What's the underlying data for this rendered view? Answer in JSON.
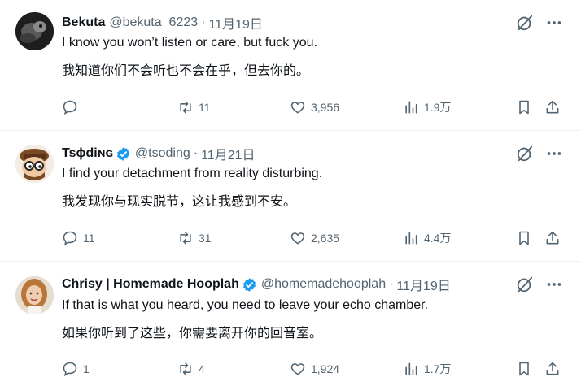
{
  "tweets": [
    {
      "name": "Bekuta",
      "handle": "@bekuta_6223",
      "time": "11月19日",
      "verified": false,
      "text_en": "I know you won’t listen or care, but fuck you.",
      "text_zh": "我知道你们不会听也不会在乎，但去你的。",
      "replies": "",
      "retweets": "11",
      "likes": "3,956",
      "views": "1.9万"
    },
    {
      "name": "Tsɸdiɴɢ",
      "handle": "@tsoding",
      "time": "11月21日",
      "verified": true,
      "text_en": "I find your detachment from reality disturbing.",
      "text_zh": "我发现你与现实脱节，这让我感到不安。",
      "replies": "11",
      "retweets": "31",
      "likes": "2,635",
      "views": "4.4万"
    },
    {
      "name": "Chrisy | Homemade Hooplah",
      "handle": "@homemadehooplah",
      "time": "11月19日",
      "verified": true,
      "text_en": "If that is what you heard, you need to leave your echo chamber.",
      "text_zh": "如果你听到了这些，你需要离开你的回音室。",
      "replies": "1",
      "retweets": "4",
      "likes": "1,924",
      "views": "1.7万"
    }
  ],
  "separator": "·",
  "colors": {
    "verified": "#1d9bf0",
    "secondary": "#536471",
    "text": "#0f1419"
  },
  "icons": [
    "grok-icon",
    "more-icon",
    "reply-icon",
    "retweet-icon",
    "like-icon",
    "views-icon",
    "bookmark-icon",
    "share-icon"
  ]
}
